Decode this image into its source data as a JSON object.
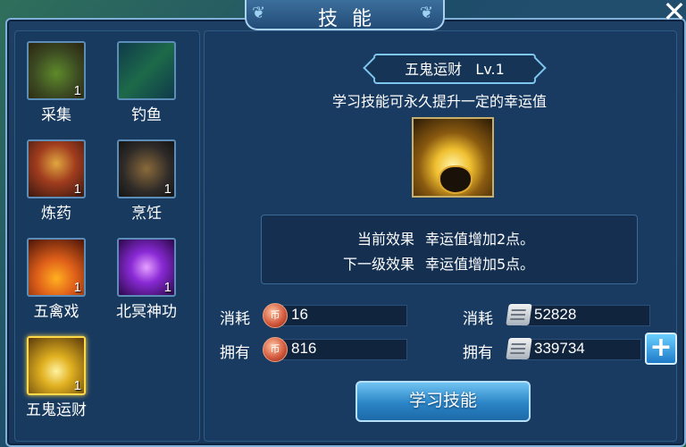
{
  "window": {
    "title": "技能",
    "close_icon": "close-icon"
  },
  "skills": [
    {
      "name": "采集",
      "level": "1",
      "icon": "gathering-basket-icon"
    },
    {
      "name": "钓鱼",
      "level": "",
      "icon": "fishing-rod-icon"
    },
    {
      "name": "炼药",
      "level": "1",
      "icon": "alchemy-furnace-icon"
    },
    {
      "name": "烹饪",
      "level": "1",
      "icon": "cooking-wok-icon"
    },
    {
      "name": "五禽戏",
      "level": "1",
      "icon": "five-animals-exercise-icon"
    },
    {
      "name": "北冥神功",
      "level": "1",
      "icon": "beiming-martial-icon"
    },
    {
      "name": "五鬼运财",
      "level": "1",
      "icon": "treasure-pot-icon",
      "selected": true
    }
  ],
  "detail": {
    "name_level": "五鬼运财   Lv.1",
    "description": "学习技能可永久提升一定的幸运值",
    "current_effect_label": "当前效果",
    "current_effect_value": "幸运值增加2点。",
    "next_effect_label": "下一级效果",
    "next_effect_value": "幸运值增加5点。"
  },
  "resources": {
    "cost_label": "消耗",
    "own_label": "拥有",
    "coin_cost": "16",
    "coin_own": "816",
    "scroll_cost": "52828",
    "scroll_own": "339734",
    "coin_symbol": "币"
  },
  "learn_button": "学习技能"
}
